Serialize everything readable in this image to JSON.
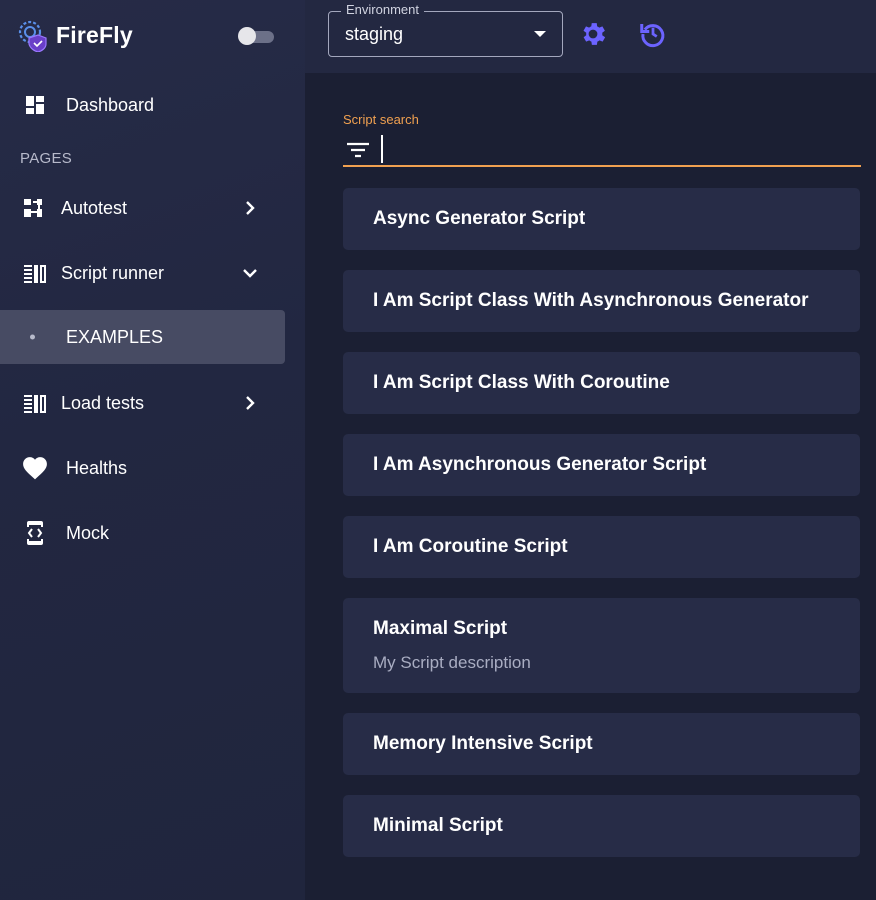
{
  "app": {
    "name": "FireFly"
  },
  "sidebar": {
    "section_header": "PAGES",
    "items": [
      {
        "label": "Dashboard",
        "icon": "dashboard-icon"
      },
      {
        "label": "Autotest",
        "icon": "autotest-icon"
      },
      {
        "label": "Script runner",
        "icon": "script-runner-icon"
      },
      {
        "label": "EXAMPLES"
      },
      {
        "label": "Load tests",
        "icon": "load-tests-icon"
      },
      {
        "label": "Healths",
        "icon": "heart-icon"
      },
      {
        "label": "Mock",
        "icon": "mock-icon"
      }
    ]
  },
  "topbar": {
    "environment_label": "Environment",
    "environment_value": "staging"
  },
  "search": {
    "label": "Script search",
    "value": ""
  },
  "scripts": [
    {
      "title": "Async Generator Script"
    },
    {
      "title": "I Am Script Class With Asynchronous Generator"
    },
    {
      "title": "I Am Script Class With Coroutine"
    },
    {
      "title": "I Am Asynchronous Generator Script"
    },
    {
      "title": "I Am Coroutine Script"
    },
    {
      "title": "Maximal Script",
      "description": "My Script description"
    },
    {
      "title": "Memory Intensive Script"
    },
    {
      "title": "Minimal Script"
    }
  ],
  "colors": {
    "accent": "#6c63ff",
    "search_focus": "#f0a050",
    "sidebar_bg": "#232841",
    "main_bg": "#1b1f33",
    "card_bg": "#272c47"
  }
}
